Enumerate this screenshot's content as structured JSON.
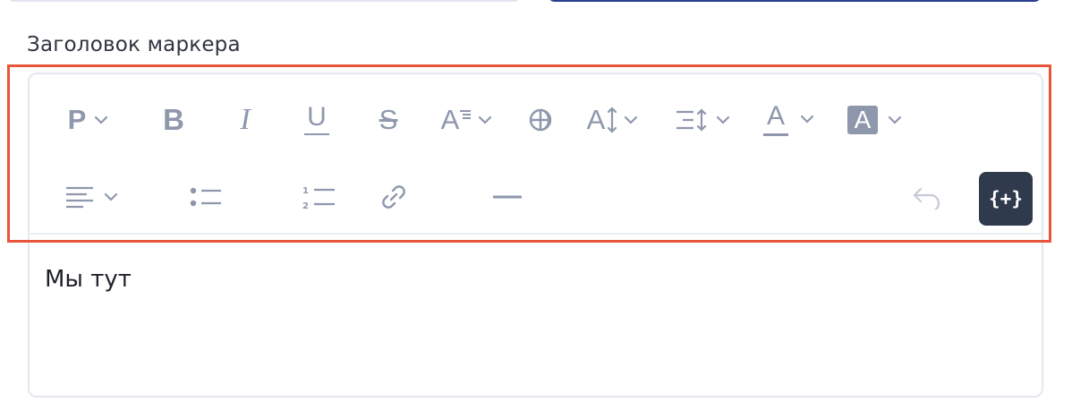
{
  "field": {
    "label": "Заголовок маркера",
    "content": "Мы тут"
  },
  "toolbar": {
    "paragraph_label": "P",
    "bold_label": "B",
    "italic_label": "I",
    "underline_label": "U",
    "strike_label": "S",
    "font_family_label": "A",
    "font_size_label": "A",
    "font_color_label": "A",
    "highlight_label": "A",
    "insert_variable_label": "{+}",
    "icons": [
      "paragraph-format-icon",
      "bold-icon",
      "italic-icon",
      "underline-icon",
      "strikethrough-icon",
      "font-family-icon",
      "special-characters-icon",
      "font-size-icon",
      "line-height-icon",
      "font-color-icon",
      "background-color-icon",
      "align-icon",
      "bullet-list-icon",
      "numbered-list-icon",
      "link-icon",
      "horizontal-rule-icon",
      "undo-icon"
    ]
  },
  "colors": {
    "icon": "#8e97ac",
    "highlight_border": "#e8553b",
    "insert_button_bg": "#2f3a4c",
    "top_field_border": "#2a3f8f"
  }
}
